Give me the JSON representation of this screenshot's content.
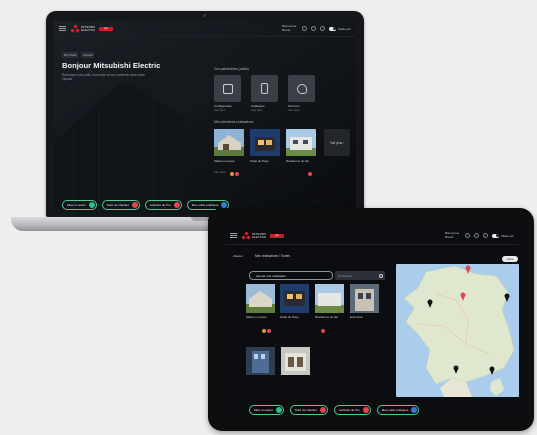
{
  "laptop": {
    "brand_text": "MITSUBISHI ELECTRIC",
    "badge_text": "pro",
    "user": {
      "line1": "Bienvenue",
      "line2": "Brand"
    },
    "mode_toggle": "Mode pro",
    "breadcrumbs": [
      "Mon Pack",
      "Accueil"
    ],
    "greeting": "Bonjour Mitsubishi Electric",
    "subtitle": "Retrouvez vos outils, mon suivi et vos contenus dans votre espace",
    "tools_section": "Vos partenaires (outils)",
    "tools": [
      {
        "name": "Configurateur",
        "sub": "Voir plus"
      },
      {
        "name": "Catalogue",
        "sub": "Voir plus"
      },
      {
        "name": "Services",
        "sub": "Voir plus"
      }
    ],
    "projects_section": "Mes dernières réalisations",
    "projects": [
      {
        "name": "Maison Lamour",
        "sub": "Voir plus"
      },
      {
        "name": "Hôtel du Pays",
        "sub": "Voir plus"
      },
      {
        "name": "Résidence du lac",
        "sub": "Voir plus"
      }
    ],
    "see_all": "Voir plus ›",
    "actions": [
      "Mise en avant",
      "Suivi de chantier",
      "Activités du Pro",
      "Mes outils pratiques"
    ]
  },
  "tablet": {
    "back": "‹ Retour",
    "title": "Mes réalisations / Toutes",
    "add_button": "Ajouter une réalisation",
    "search_placeholder": "Recherche",
    "view_button": "Carte",
    "projects": [
      {
        "name": "Maison Lamour"
      },
      {
        "name": "Hôtel du Pays"
      },
      {
        "name": "Résidence du lac"
      },
      {
        "name": "Extension"
      }
    ],
    "actions": [
      "Mise en avant",
      "Suivi de chantier",
      "Activités du Pro",
      "Mes outils pratiques"
    ]
  },
  "colors": {
    "accent_green": "#4ecb8d",
    "brand_red": "#d9222a",
    "cap_teal": "#2ec08a",
    "cap_orange": "#f08a2c",
    "cap_red": "#e0464b",
    "cap_blue": "#3a7bd5"
  }
}
